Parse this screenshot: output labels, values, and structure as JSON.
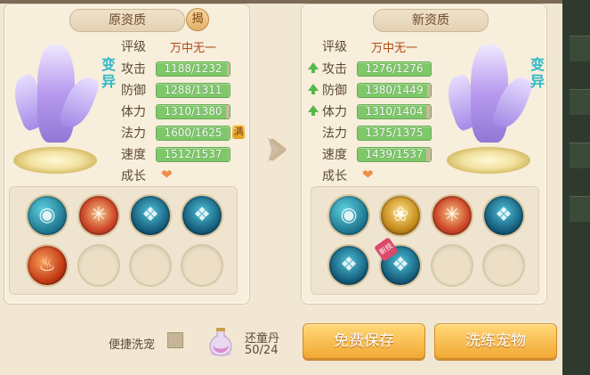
{
  "left_panel": {
    "title": "原资质",
    "reveal_button": "揭",
    "variant_tag": "变\n异",
    "rank_label": "评级",
    "rank_value": "万中无一",
    "stats": [
      {
        "label": "攻击",
        "value": "1188/1232",
        "fill": 0.964
      },
      {
        "label": "防御",
        "value": "1288/1311",
        "fill": 0.982
      },
      {
        "label": "体力",
        "value": "1310/1380",
        "fill": 0.949
      },
      {
        "label": "法力",
        "value": "1600/1625",
        "fill": 0.985,
        "badge": "满"
      },
      {
        "label": "速度",
        "value": "1512/1537",
        "fill": 0.984
      }
    ],
    "growth_label": "成长",
    "skills": [
      "teal",
      "red",
      "darkteal",
      "darkteal",
      "fire",
      "empty",
      "empty",
      "empty"
    ]
  },
  "right_panel": {
    "title": "新资质",
    "variant_tag": "变\n异",
    "rank_label": "评级",
    "rank_value": "万中无一",
    "stats": [
      {
        "label": "攻击",
        "value": "1276/1276",
        "fill": 1.0,
        "up": true
      },
      {
        "label": "防御",
        "value": "1380/1449",
        "fill": 0.952,
        "up": true
      },
      {
        "label": "体力",
        "value": "1310/1404",
        "fill": 0.933,
        "up": true
      },
      {
        "label": "法力",
        "value": "1375/1375",
        "fill": 1.0,
        "up": false
      },
      {
        "label": "速度",
        "value": "1439/1537",
        "fill": 0.936,
        "up": false
      }
    ],
    "growth_label": "成长",
    "skills": [
      "teal",
      "gold",
      "red",
      "darkteal",
      "darkteal",
      "darkteal",
      "empty",
      "empty"
    ],
    "new_skill_badge": "新技"
  },
  "bottom": {
    "quick_wash_label": "便捷洗宠",
    "item_name": "还童丹",
    "item_count": "50/24",
    "save_button": "免费保存",
    "train_button": "洗练宠物"
  },
  "colors": {
    "bar_fill": "#7ec86a",
    "rank_text": "#b04a18",
    "variant_text": "#2fb8c9",
    "button": "#f2a833"
  }
}
